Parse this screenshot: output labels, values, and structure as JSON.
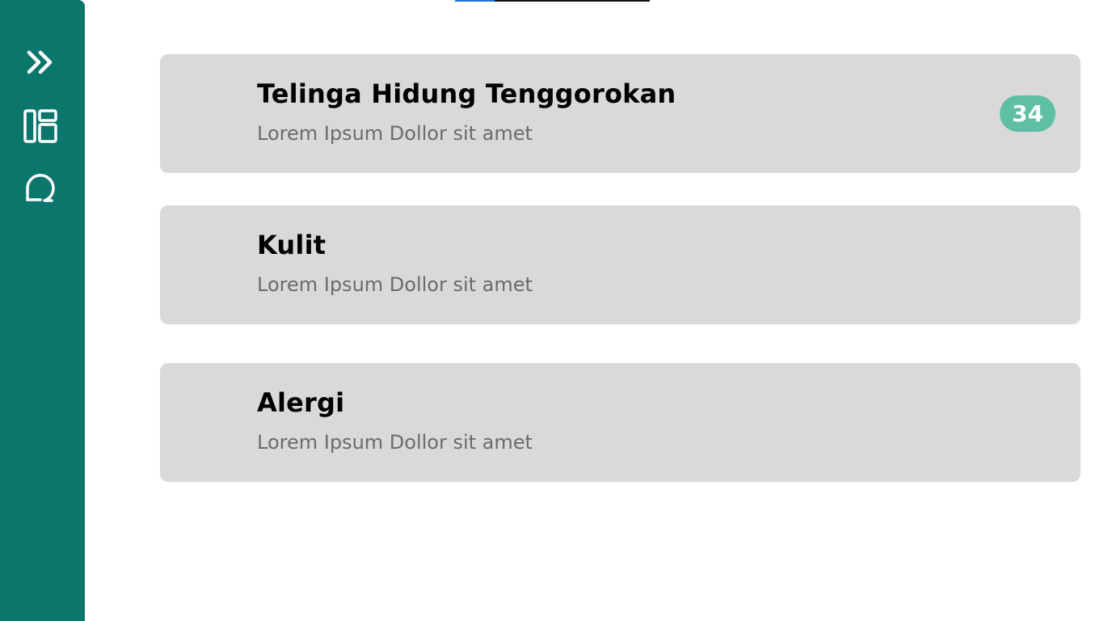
{
  "colors": {
    "sidebar": "#0b766c",
    "card": "#d9d9d9",
    "badge": "#5ebfa4",
    "tab_accent": "#1e74d6"
  },
  "sidebar": {
    "items": [
      {
        "icon": "chevrons-right-icon"
      },
      {
        "icon": "dashboard-layout-icon"
      },
      {
        "icon": "chat-bubble-icon"
      }
    ]
  },
  "categories": [
    {
      "title": "Telinga Hidung Tenggorokan",
      "subtitle": "Lorem Ipsum Dollor sit amet",
      "badge": "34"
    },
    {
      "title": "Kulit",
      "subtitle": "Lorem Ipsum Dollor sit amet"
    },
    {
      "title": "Alergi",
      "subtitle": "Lorem Ipsum Dollor sit amet"
    }
  ]
}
